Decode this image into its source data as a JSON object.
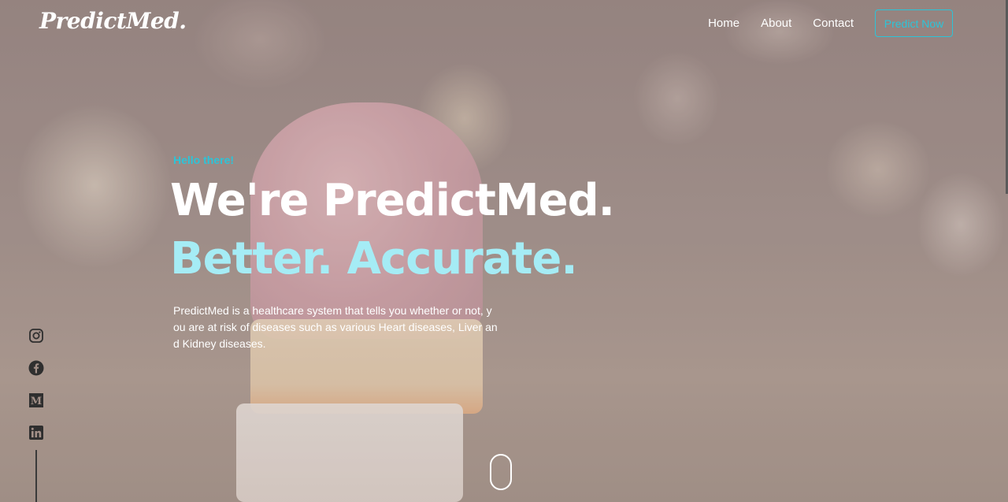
{
  "brand": {
    "logo_text": "PredictMed."
  },
  "nav": {
    "items": [
      {
        "label": "Home"
      },
      {
        "label": "About"
      },
      {
        "label": "Contact"
      }
    ],
    "cta_label": "Predict Now"
  },
  "hero": {
    "greeting": "Hello there!",
    "headline": "We're PredictMed.",
    "subheadline": "Better. Accurate.",
    "description": "PredictMed is a healthcare system that tells you whether or not, you are at risk of diseases such as various Heart diseases, Liver and Kidney diseases."
  },
  "social": {
    "icons": [
      "instagram-icon",
      "facebook-icon",
      "medium-icon",
      "linkedin-icon"
    ]
  },
  "colors": {
    "accent": "#2cc4d8",
    "subheadline": "#a5ecf5",
    "text": "#ffffff"
  }
}
